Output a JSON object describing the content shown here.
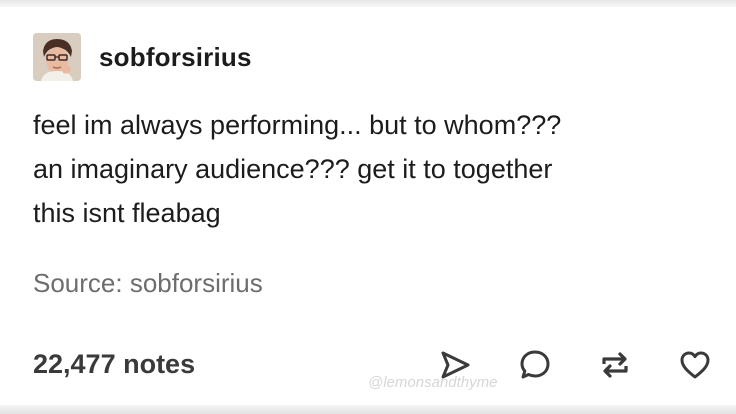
{
  "post": {
    "username": "sobforsirius",
    "body_lines": [
      "feel im always performing... but to whom???",
      "an imaginary audience??? get it to together",
      "this isnt fleabag"
    ],
    "source_text": "Source: sobforsirius",
    "notes_text": "22,477 notes"
  },
  "actions": {
    "share_icon": "share-arrow-icon",
    "reply_icon": "reply-bubble-icon",
    "reblog_icon": "reblog-icon",
    "like_icon": "heart-icon"
  },
  "watermark": "@lemonsandthyme",
  "colors": {
    "text": "#1c1c1c",
    "source": "#6d6d6d",
    "icon": "#3a3a3a"
  }
}
